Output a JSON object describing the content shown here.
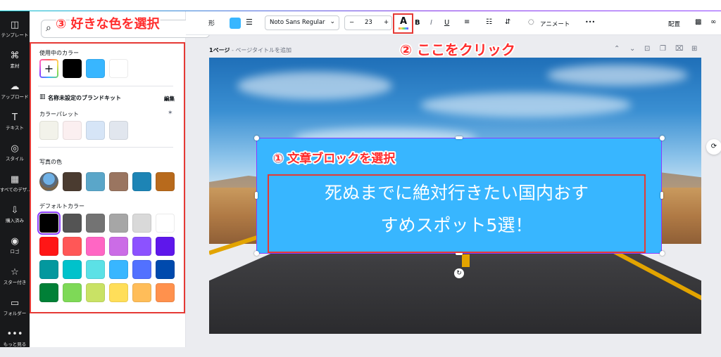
{
  "left_rail": {
    "items": [
      {
        "label": "テンプレート",
        "icon": "template-icon",
        "glyph": "◫"
      },
      {
        "label": "素材",
        "icon": "elements-icon",
        "glyph": "⌘"
      },
      {
        "label": "アップロード",
        "icon": "upload-icon",
        "glyph": "☁"
      },
      {
        "label": "テキスト",
        "icon": "text-icon",
        "glyph": "T"
      },
      {
        "label": "スタイル",
        "icon": "style-icon",
        "glyph": "◎"
      },
      {
        "label": "すべてのデザ...",
        "icon": "designs-icon",
        "glyph": "▦"
      },
      {
        "label": "購入済み",
        "icon": "purchased-icon",
        "glyph": "⇩"
      },
      {
        "label": "ロゴ",
        "icon": "logo-icon",
        "glyph": "◉"
      },
      {
        "label": "スター付き",
        "icon": "starred-icon",
        "glyph": "☆"
      },
      {
        "label": "フォルダー",
        "icon": "folder-icon",
        "glyph": "▭"
      },
      {
        "label": "もっと見る",
        "icon": "more-icon",
        "glyph": "•••"
      }
    ]
  },
  "color_panel": {
    "search_icon": "search-icon",
    "in_use_title": "使用中のカラー",
    "in_use_colors": [
      "#000000",
      "#38b6ff",
      "#ffffff"
    ],
    "brand_kit_title": "名称未設定のブランドキット",
    "brand_kit_edit": "編集",
    "palette_title": "カラーパレット",
    "palette_colors": [
      "#f2f2ea",
      "#fbeff0",
      "#d6e5f7",
      "#e1e6ee"
    ],
    "photo_title": "写真の色",
    "photo_colors": [
      "#4a3b30",
      "#5aa6c9",
      "#9a7560",
      "#1d84b5",
      "#b86a1c"
    ],
    "default_title": "デフォルトカラー",
    "default_colors": [
      [
        "#000000",
        "#545454",
        "#737373",
        "#a6a6a6",
        "#d9d9d9",
        "#ffffff"
      ],
      [
        "#ff1616",
        "#ff5757",
        "#ff66c4",
        "#cb6ce6",
        "#8c52ff",
        "#5e17eb"
      ],
      [
        "#03989e",
        "#00c2cb",
        "#5ce1e6",
        "#38b6ff",
        "#5271ff",
        "#004aad"
      ],
      [
        "#008037",
        "#7ed957",
        "#c9e265",
        "#ffde59",
        "#ffbd59",
        "#ff914d"
      ]
    ]
  },
  "toolbar": {
    "shape_label": "形",
    "font_name": "Noto Sans Regular",
    "minus": "−",
    "font_size": "23",
    "plus": "+",
    "bold": "B",
    "italic": "I",
    "underline": "U",
    "animate_label": "アニメート",
    "more": "•••",
    "position_label": "配置"
  },
  "canvas": {
    "page_label_bold": "1ページ",
    "page_label_rest": " - ページタイトルを追加",
    "text_line1": "死ぬまでに絶対行きたい国内おす",
    "text_line2": "すめスポット5選！"
  },
  "annotations": {
    "step1": "① 文章ブロックを選択",
    "step2": "② ここをクリック",
    "step3": "③ 好きな色を選択"
  },
  "colors": {
    "accent": "#8b3dff",
    "annotation_red": "#ff2d2d",
    "text_block_bg": "#38b6ff"
  }
}
